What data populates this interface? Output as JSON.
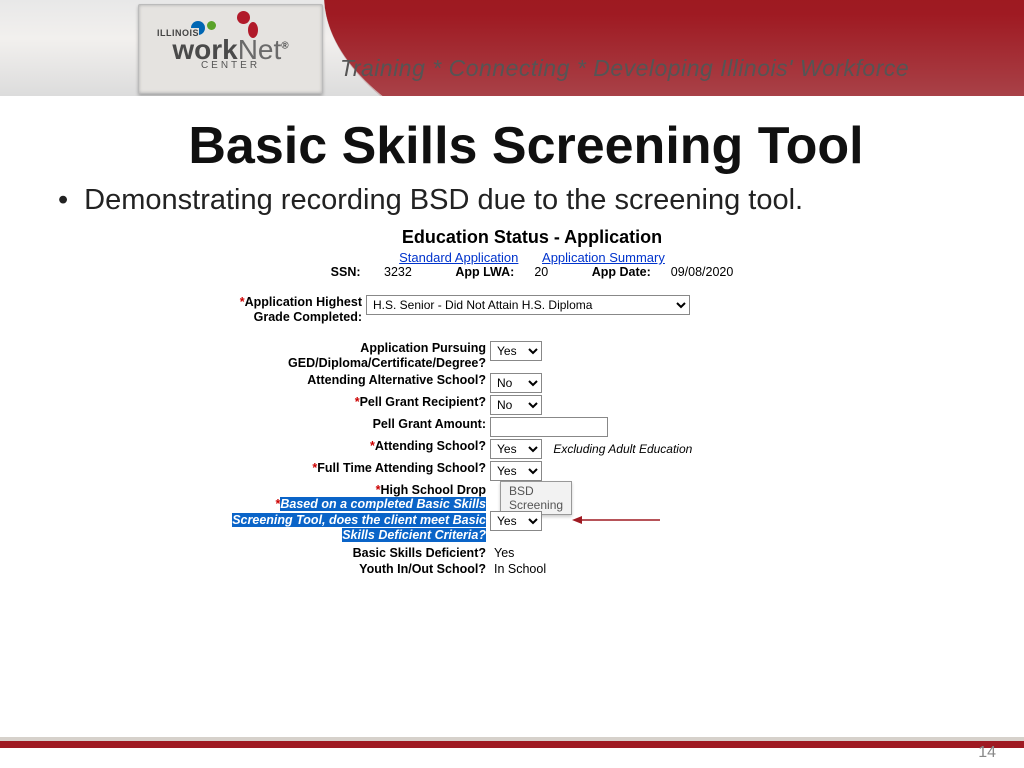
{
  "banner": {
    "tagline": "Training  *  Connecting  *  Developing Illinois' Workforce",
    "logo_state": "ILLINOIS",
    "logo_brand1": "work",
    "logo_brand2": "Net",
    "logo_reg": "®",
    "logo_center": "CENTER"
  },
  "slide": {
    "title": "Basic Skills Screening Tool",
    "bullet1": "Demonstrating recording BSD due to the screening tool."
  },
  "form": {
    "heading": "Education Status - Application",
    "link1": "Standard Application",
    "link2": "Application Summary",
    "ssn_label": "SSN:",
    "ssn_value": "3232",
    "lwa_label": "App LWA:",
    "lwa_value": "20",
    "date_label": "App Date:",
    "date_value": "09/08/2020",
    "highest_grade_label": "Application Highest Grade Completed:",
    "highest_grade_value": "H.S. Senior - Did Not Attain H.S. Diploma",
    "pursuing_label": "Application Pursuing GED/Diploma/Certificate/Degree?",
    "pursuing_value": "Yes",
    "alt_school_label": "Attending Alternative School?",
    "alt_school_value": "No",
    "pell_recipient_label": "Pell Grant Recipient?",
    "pell_recipient_value": "No",
    "pell_amount_label": "Pell Grant Amount:",
    "pell_amount_value": "",
    "attending_school_label": "Attending School?",
    "attending_school_value": "Yes",
    "attending_school_note": "Excluding Adult Education",
    "fulltime_label": "Full Time Attending School?",
    "fulltime_value": "Yes",
    "hs_drop_label": "High School Drop",
    "bsd_tool_label": "Based on a completed Basic Skills Screening Tool, does the client meet Basic Skills Deficient Criteria?",
    "bsd_tool_value": "Yes",
    "bsd_label": "Basic Skills Deficient?",
    "bsd_value": "Yes",
    "youth_label": "Youth In/Out School?",
    "youth_value": "In School",
    "tooltip": "BSD Screening"
  },
  "page_number": "14"
}
